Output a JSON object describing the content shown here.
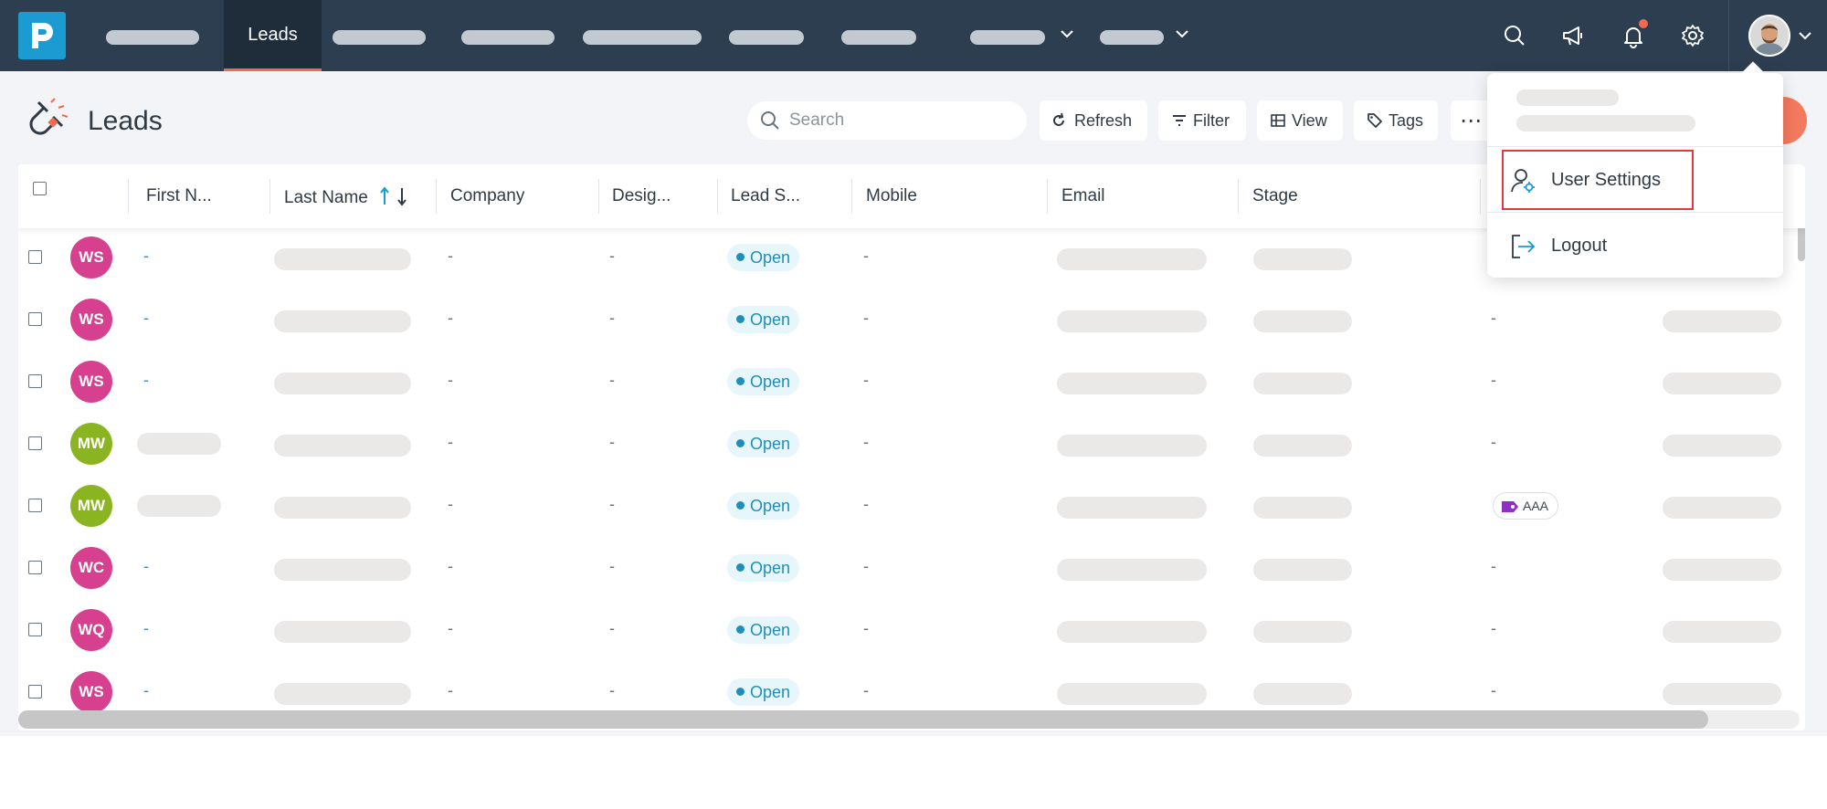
{
  "nav": {
    "active_tab": "Leads",
    "hidden_tab_count": 8
  },
  "page": {
    "title": "Leads"
  },
  "toolbar": {
    "search_placeholder": "Search",
    "refresh_label": "Refresh",
    "filter_label": "Filter",
    "view_label": "View",
    "tags_label": "Tags",
    "more_label": "⋯"
  },
  "table": {
    "columns": [
      "First N...",
      "Last Name",
      "Company",
      "Desig...",
      "Lead S...",
      "Mobile",
      "Email",
      "Stage"
    ],
    "sort": {
      "column": "Last Name",
      "direction": "ascending"
    },
    "rows": [
      {
        "initials": "WS",
        "avatar_color": "#d6408f",
        "first_name": "-",
        "company": "-",
        "designation": "-",
        "status": "Open",
        "mobile": "-",
        "tags": ""
      },
      {
        "initials": "WS",
        "avatar_color": "#d6408f",
        "first_name": "-",
        "company": "-",
        "designation": "-",
        "status": "Open",
        "mobile": "-",
        "tags": "-"
      },
      {
        "initials": "WS",
        "avatar_color": "#d6408f",
        "first_name": "-",
        "company": "-",
        "designation": "-",
        "status": "Open",
        "mobile": "-",
        "tags": "-"
      },
      {
        "initials": "MW",
        "avatar_color": "#8bb520",
        "first_name": "",
        "company": "-",
        "designation": "-",
        "status": "Open",
        "mobile": "-",
        "tags": "-"
      },
      {
        "initials": "MW",
        "avatar_color": "#8bb520",
        "first_name": "",
        "company": "-",
        "designation": "-",
        "status": "Open",
        "mobile": "-",
        "tags": "AAA"
      },
      {
        "initials": "WC",
        "avatar_color": "#d6408f",
        "first_name": "-",
        "company": "-",
        "designation": "-",
        "status": "Open",
        "mobile": "-",
        "tags": "-"
      },
      {
        "initials": "WQ",
        "avatar_color": "#d6408f",
        "first_name": "-",
        "company": "-",
        "designation": "-",
        "status": "Open",
        "mobile": "-",
        "tags": "-"
      },
      {
        "initials": "WS",
        "avatar_color": "#d6408f",
        "first_name": "-",
        "company": "-",
        "designation": "-",
        "status": "Open",
        "mobile": "-",
        "tags": "-"
      }
    ]
  },
  "user_menu": {
    "items": [
      {
        "label": "User Settings",
        "icon": "user-settings-icon",
        "highlighted": true
      },
      {
        "label": "Logout",
        "icon": "logout-icon",
        "highlighted": false
      }
    ]
  },
  "colors": {
    "nav_bg": "#2c3e50",
    "accent": "#ef6a50",
    "brand": "#1b9bd1",
    "status_text": "#1e8fb8",
    "highlight_border": "#e03a3a"
  }
}
